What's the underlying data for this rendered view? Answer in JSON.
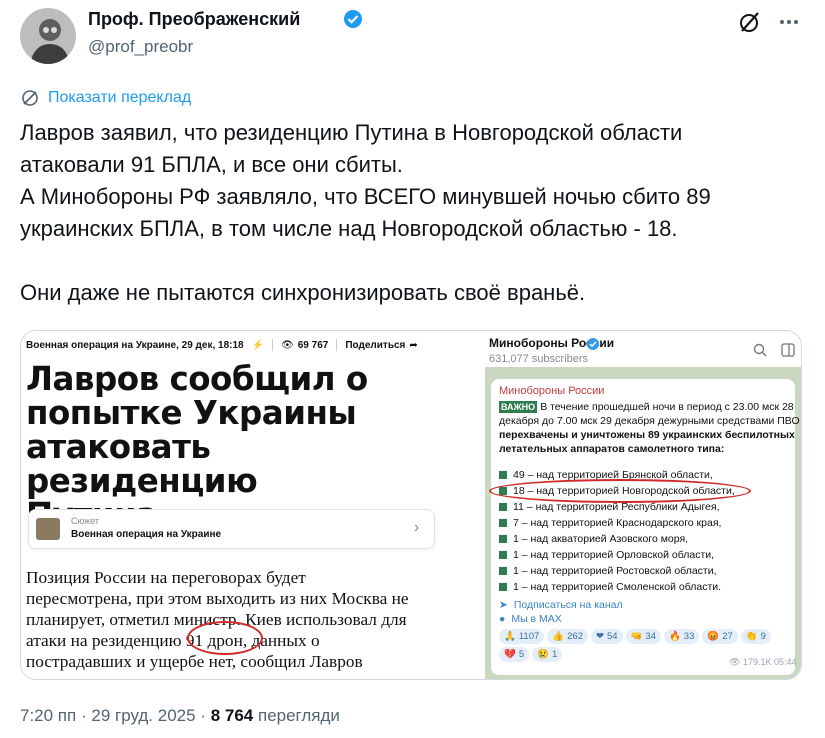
{
  "author": {
    "name": "Проф. Преображенский",
    "handle": "@prof_preobr"
  },
  "translate_label": "Показати переклад",
  "tweet": {
    "p1_l1": "Лавров заявил, что резиденцию Путина в Новгородской области",
    "p1_l2": "атаковали 91 БПЛА, и все они сбиты.",
    "p1_l3": "А Минобороны РФ заявляло, что ВСЕГО минувшей ночью сбито 89",
    "p1_l4": "украинских БПЛА, в том числе над Новгородской областью - 18.",
    "p2": "Они даже не пытаются синхронизировать своё враньё."
  },
  "news": {
    "topbar_left": "Военная операция на Украине, 29 дек, 18:18",
    "views": "69 767",
    "share": "Поделиться",
    "headline_1": "Лавров сообщил о",
    "headline_2": "попытке Украины",
    "headline_3": "атаковать резиденцию",
    "headline_4": "Путина",
    "plot_sub": "Сюжет",
    "plot_title": "Военная операция на Украине",
    "article_1": "Позиция России на переговорах будет",
    "article_2": "пересмотрена, при этом выходить из них Москва не",
    "article_3": "планирует, отметил министр. Киев использовал для",
    "article_4": "атаки на резиденцию 91 дрон, данных о",
    "article_5": "пострадавших и ущербе нет, сообщил Лавров"
  },
  "telegram": {
    "channel_name": "Минобороны России",
    "subscribers": "631,077 subscribers",
    "bubble_channel": "Минобороны России",
    "badge": "ВАЖНО",
    "line1": "В течение прошедшей ночи в период с 23.00 мск 28",
    "line2": "декабря до 7.00 мск 29 декабря дежурными средствами ПВО",
    "line3": "перехвачены и уничтожены 89 украинских беспилотных",
    "line4": "летательных аппаратов самолетного типа:",
    "items": [
      "49 – над территорией Брянской области,",
      "18 – над территорией Новгородской области,",
      "11 – над территорией Республики Адыгея,",
      "7 – над территорией Краснодарского края,",
      "1 – над акваторией Азовского моря,",
      "1 – над территорией Орловской области,",
      "1 – над территорией Ростовской области,",
      "1 – над территорией Смоленской области."
    ],
    "link1": "Подписаться на канал",
    "link2": "Мы в MAX",
    "reactions": [
      {
        "emoji": "🙏",
        "count": "1107"
      },
      {
        "emoji": "👍",
        "count": "262"
      },
      {
        "emoji": "❤",
        "count": "54"
      },
      {
        "emoji": "🤜",
        "count": "34"
      },
      {
        "emoji": "🔥",
        "count": "33"
      },
      {
        "emoji": "😡",
        "count": "27"
      },
      {
        "emoji": "👏",
        "count": "9"
      },
      {
        "emoji": "💔",
        "count": "5"
      },
      {
        "emoji": "😢",
        "count": "1"
      }
    ],
    "views": "179.1K",
    "time": "05:44"
  },
  "footer": {
    "time": "7:20 пп",
    "date": "29 груд. 2025",
    "views": "8 764",
    "views_label": "перегляди"
  },
  "colors": {
    "accent": "#1d9bf0",
    "text": "#0f1419",
    "muted": "#536471",
    "highlight": "#d12a2a"
  }
}
